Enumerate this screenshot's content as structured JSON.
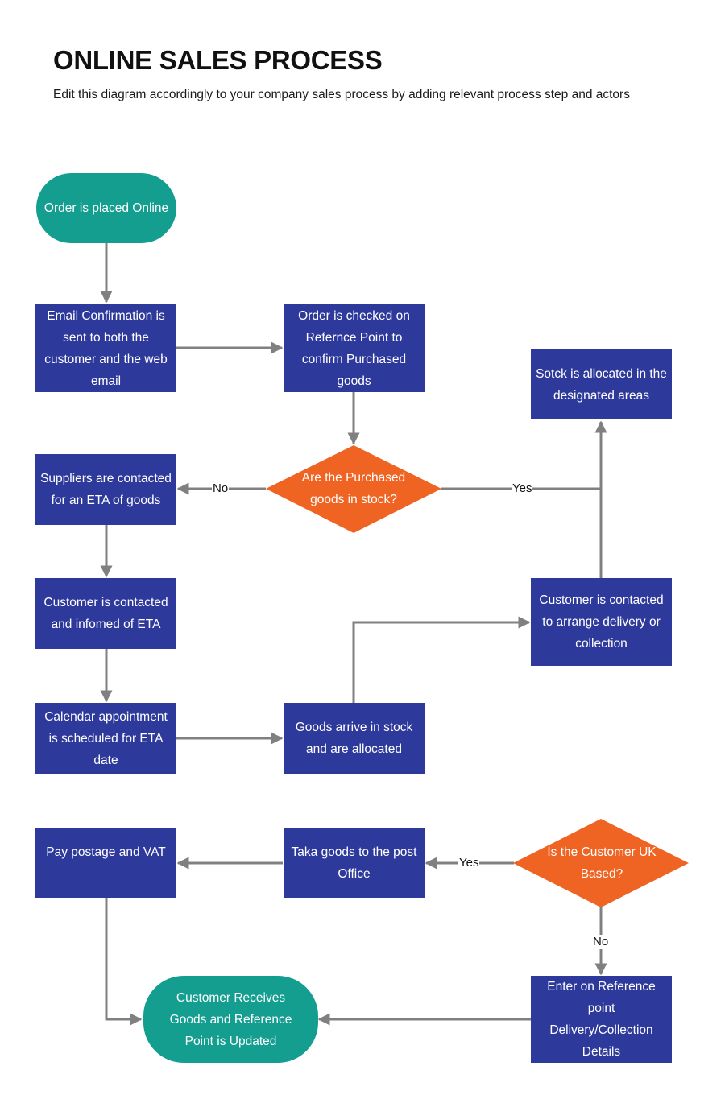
{
  "header": {
    "title": "ONLINE SALES PROCESS",
    "subtitle": "Edit this diagram accordingly to your company sales process by adding relevant process step and actors"
  },
  "colors": {
    "process": "#2e3a9b",
    "terminal": "#139e90",
    "decision": "#f06423",
    "connector": "#808080"
  },
  "nodes": {
    "start": "Order is placed Online",
    "email_confirmation": "Email Confirmation is sent to both the customer and the web email",
    "order_checked": "Order is checked on Refernce Point to confirm Purchased goods",
    "stock_allocated": "Sotck is allocated in the designated areas",
    "in_stock_decision": "Are the Purchased goods in stock?",
    "suppliers_contacted": "Suppliers are contacted for an ETA of goods",
    "customer_informed": "Customer is contacted and infomed of  ETA",
    "calendar_appointment": "Calendar appointment is scheduled for ETA date",
    "goods_arrive": "Goods arrive in stock and are allocated",
    "arrange_delivery": "Customer is contacted to arrange delivery or collection",
    "pay_postage": "Pay postage and VAT",
    "post_office": "Taka goods to the post Office",
    "uk_decision": "Is the Customer UK Based?",
    "enter_reference": "Enter on Reference point Delivery/Collection Details",
    "end": "Customer Receives Goods and Reference Point is Updated"
  },
  "edge_labels": {
    "in_stock_no": "No",
    "in_stock_yes": "Yes",
    "uk_yes": "Yes",
    "uk_no": "No"
  }
}
